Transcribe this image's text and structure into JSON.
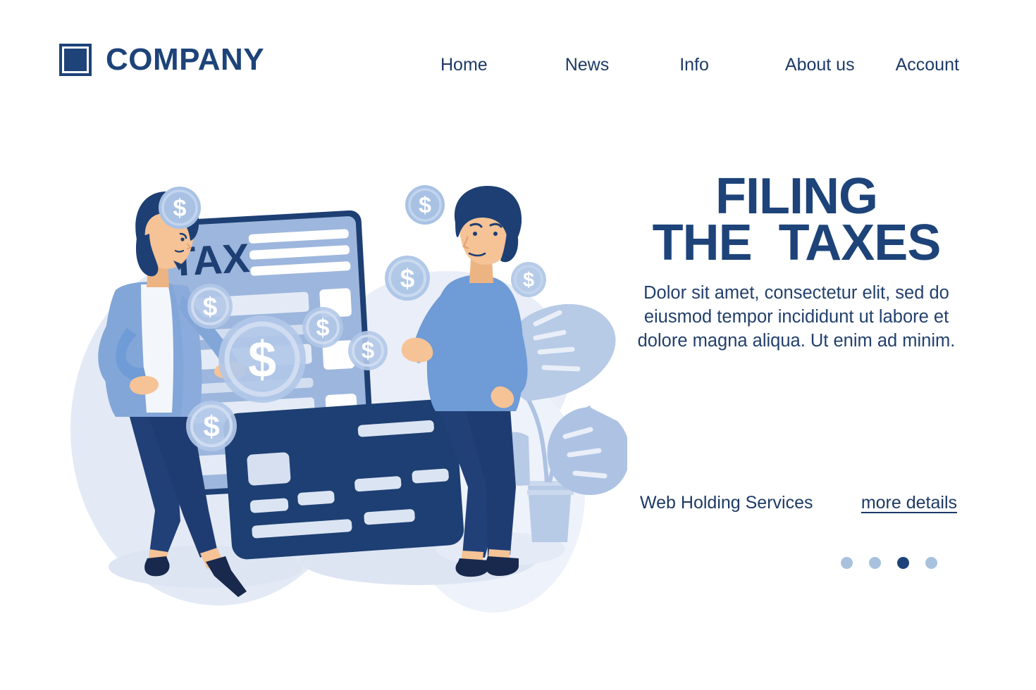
{
  "brand": {
    "logo_icon": "square-logo-icon",
    "name": "COMPANY"
  },
  "nav": {
    "items": [
      {
        "label": "Home"
      },
      {
        "label": "News"
      },
      {
        "label": "Info"
      },
      {
        "label": "About us"
      },
      {
        "label": "Account"
      }
    ]
  },
  "hero": {
    "title_line1": "FILING",
    "title_line2": "THE  TAXES",
    "subtitle": "Dolor sit amet, consectetur  elit, sed do eiusmod tempor incididunt ut labore et dolore magna aliqua. Ut enim ad minim.",
    "services_label": "Web Holding Services",
    "more_details_label": "more details",
    "carousel": {
      "total": 4,
      "active_index": 3
    }
  },
  "illustration": {
    "document_label": "TAX",
    "coin_symbol": "$",
    "alt": "Two people standing beside a large tax form document, a credit card and floating dollar coins"
  },
  "colors": {
    "navy": "#1d4379",
    "navy_text": "#1d3a66",
    "body_text": "#22406d",
    "dot_inactive": "#a8c2de",
    "dot_active": "#1d4379",
    "doc_fill": "#9db6dd",
    "doc_border": "#1d3f73",
    "card_fill": "#1d3f73",
    "shirt_blue": "#6f9bd6",
    "jacket_blue": "#82a6d8",
    "skin": "#f5c396",
    "hair_navy": "#1d3f73",
    "pants_navy": "#214078",
    "blob_bg": "#e3eaf6",
    "plant_leaf": "#b7cae6",
    "white": "#ffffff"
  }
}
